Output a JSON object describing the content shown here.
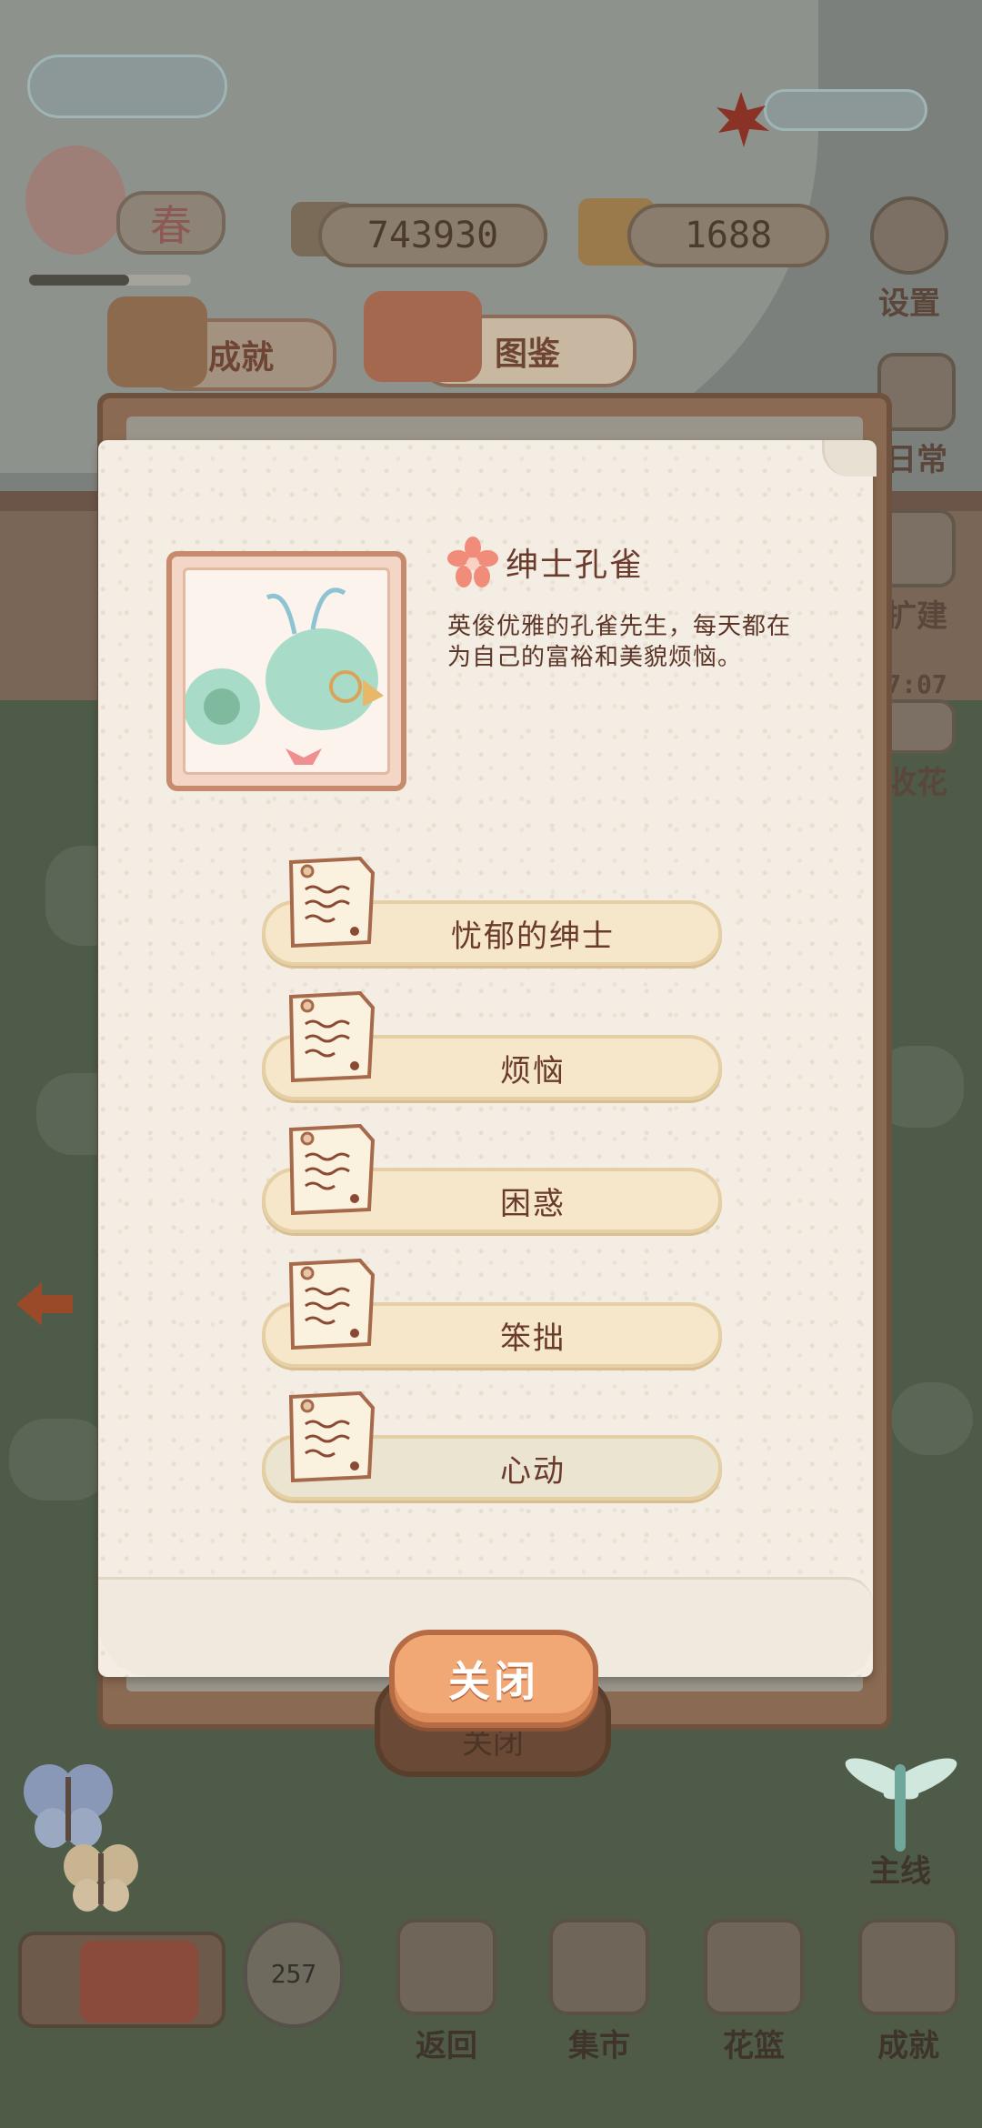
{
  "hud": {
    "season": "春",
    "season_progress": 0.62,
    "fish_count": "743930",
    "cheese_count": "1688",
    "settings_label": "设置"
  },
  "side_menu": {
    "items": [
      {
        "label": "日常",
        "icon": "daily-icon"
      },
      {
        "label": "扩建",
        "icon": "expand-icon"
      },
      {
        "label": "7:07",
        "icon": "timer-icon"
      },
      {
        "label": "收花",
        "icon": "flower-icon"
      }
    ],
    "mainline_label": "主线"
  },
  "tabs": [
    {
      "label": "成就",
      "icon": "trophy-icon"
    },
    {
      "label": "图鉴",
      "icon": "book-icon"
    }
  ],
  "character": {
    "name": "绅士孔雀",
    "description": "英俊优雅的孔雀先生，每天都在为自己的富裕和美貌烦恼。"
  },
  "entries": [
    {
      "label": "忧郁的绅士",
      "dim": false
    },
    {
      "label": "烦恼",
      "dim": false
    },
    {
      "label": "困惑",
      "dim": false
    },
    {
      "label": "笨拙",
      "dim": false
    },
    {
      "label": "心动",
      "dim": true
    }
  ],
  "close_label": "关闭",
  "behind_close_label": "关闭",
  "bottom_bar": {
    "timer": "257",
    "items": [
      {
        "label": "返回",
        "icon": "window-icon"
      },
      {
        "label": "集市",
        "icon": "market-stall-icon"
      },
      {
        "label": "花篮",
        "icon": "flower-basket-icon"
      },
      {
        "label": "成就",
        "icon": "trophy-icon"
      }
    ]
  },
  "colors": {
    "accent_orange": "#f2a874",
    "paper": "#f3ede3",
    "entry_bar": "#f6e7cb",
    "text_brown": "#6b3a2b"
  }
}
